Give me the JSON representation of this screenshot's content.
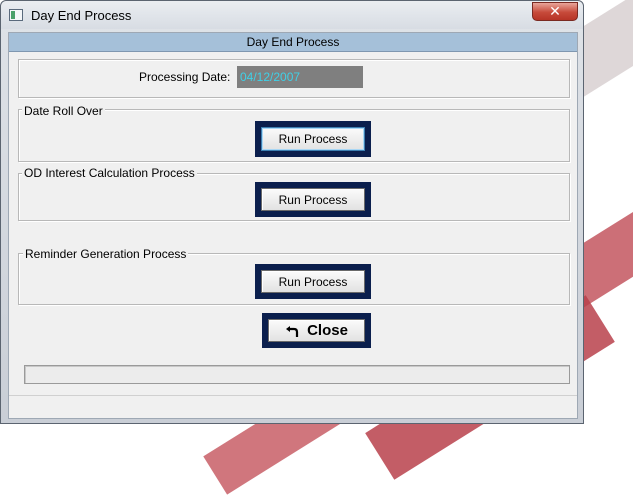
{
  "window": {
    "title": "Day End Process",
    "close_glyph": "✕"
  },
  "header": {
    "title": "Day End Process"
  },
  "processing": {
    "label": "Processing Date:",
    "value": "04/12/2007"
  },
  "groups": [
    {
      "legend": "Date Roll Over",
      "button_label": "Run Process"
    },
    {
      "legend": "OD Interest Calculation Process",
      "button_label": "Run Process"
    },
    {
      "legend": "Reminder Generation Process",
      "button_label": "Run Process"
    }
  ],
  "close_button": {
    "label": "Close",
    "icon": "undo-arrow-icon"
  },
  "colors": {
    "header_bar": "#a5c0d9",
    "date_field_bg": "#7f7f7f",
    "date_field_text": "#3fd0e6",
    "button_frame": "#0b1f4d"
  }
}
